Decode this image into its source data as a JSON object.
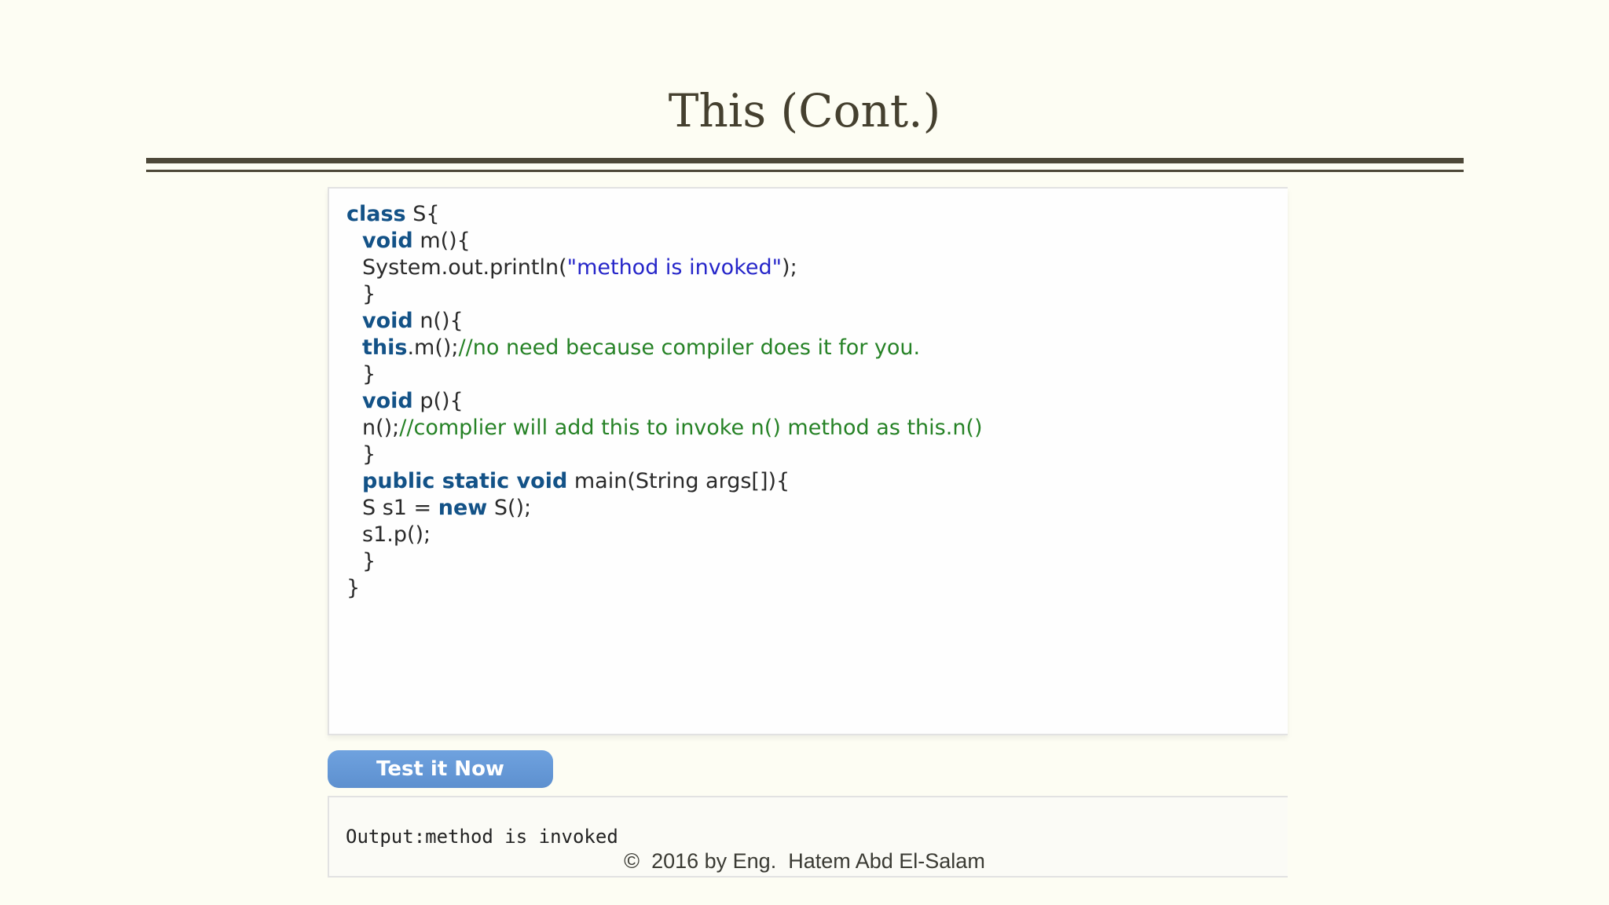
{
  "slide": {
    "title": "This (Cont.)"
  },
  "code": {
    "lines": [
      {
        "kw": "class",
        "rest": " S{"
      },
      {
        "kw": "void",
        "rest": " m(){"
      },
      {
        "pre": "System.out.println(",
        "str": "\"method is invoked\"",
        "post": ");"
      },
      {
        "text": "}"
      },
      {
        "kw": "void",
        "rest": " n(){"
      },
      {
        "kw": "this",
        "rest": ".m();",
        "comment": "//no need because compiler does it for you."
      },
      {
        "text": "}"
      },
      {
        "kw": "void",
        "rest": " p(){"
      },
      {
        "pre": "n();",
        "comment": "//complier will add this to invoke n() method as this.n()"
      },
      {
        "text": "}"
      },
      {
        "kw": "public static void",
        "rest": " main(String args[]){"
      },
      {
        "pre": "S s1 = ",
        "kw": "new",
        "rest": " S();"
      },
      {
        "text": "s1.p();"
      },
      {
        "text": "}"
      },
      {
        "text": "}"
      }
    ]
  },
  "actions": {
    "test_button_label": "Test it Now"
  },
  "output": {
    "text": "Output:method is invoked"
  },
  "footer": {
    "copyright": "©  2016 by Eng.  Hatem Abd El-Salam"
  },
  "colors": {
    "background": "#fdfdf3",
    "keyword": "#135287",
    "string": "#2525c9",
    "comment": "#268226",
    "button": "#6fa2df"
  }
}
